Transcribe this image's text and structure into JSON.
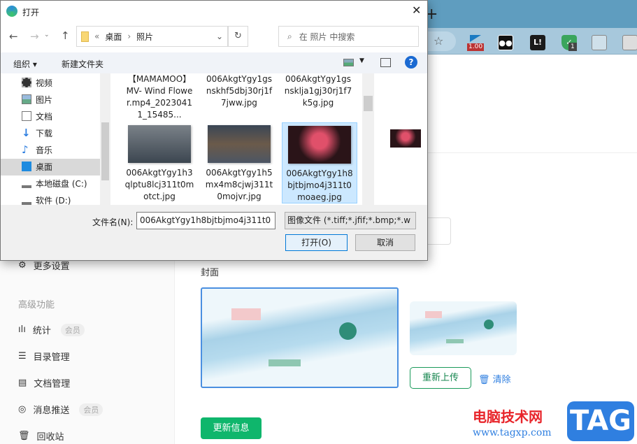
{
  "browser": {
    "new_tab": "+",
    "extensions": [
      {
        "name": "ext-flag",
        "badge": "1.00"
      },
      {
        "name": "ext-owl"
      },
      {
        "name": "ext-l",
        "label": "L!"
      },
      {
        "name": "ext-shield",
        "badge": "1"
      },
      {
        "name": "ext-image"
      },
      {
        "name": "ext-copy"
      }
    ]
  },
  "sidebar": {
    "more_settings": "更多设置",
    "section": "高级功能",
    "items": [
      {
        "label": "统计",
        "badge": "会员"
      },
      {
        "label": "目录管理"
      },
      {
        "label": "文档管理"
      },
      {
        "label": "消息推送",
        "badge": "会员"
      },
      {
        "label": "回收站"
      }
    ]
  },
  "main": {
    "cover_label": "封面",
    "reupload": "重新上传",
    "clear": "清除",
    "update": "更新信息"
  },
  "watermark": {
    "site": "电脑技术网",
    "url": "www.tagxp.com",
    "logo": "TAG"
  },
  "dialog": {
    "title": "打开",
    "breadcrumb": [
      "桌面",
      "照片"
    ],
    "breadcrumb_prefix": "«",
    "search_placeholder": "在 照片 中搜索",
    "organize": "组织 ▾",
    "new_folder": "新建文件夹",
    "help": "?",
    "nav": [
      "视频",
      "图片",
      "文档",
      "下载",
      "音乐",
      "桌面",
      "本地磁盘 (C:)",
      "软件 (D:)"
    ],
    "files": [
      {
        "name": "【MAMAMOO】MV- Wind Flower.mp4_20230411_15485...",
        "lines": [
          "【MAMAMOO",
          "】MV- Wind",
          "Flower.mp4_20",
          "230411_15485..."
        ]
      },
      {
        "lines": [
          "006AkgtYgy1gs",
          "nskhf5dbj30rj1f",
          "7jww.jpg"
        ]
      },
      {
        "lines": [
          "006AkgtYgy1gs",
          "nsklja1gj30rj1f7",
          "k5g.jpg"
        ]
      },
      {
        "lines": [
          "006AkgtYgy1h3",
          "qlptu8lcj311t0m",
          "otct.jpg"
        ]
      },
      {
        "lines": [
          "006AkgtYgy1h5",
          "mx4m8cjwj311t",
          "0mojvr.jpg"
        ]
      },
      {
        "lines": [
          "006AkgtYgy1h8",
          "bjtbjmo4j311t0",
          "moaeg.jpg"
        ]
      }
    ],
    "filename_label": "文件名(N):",
    "filename_value": "006AkgtYgy1h8bjtbjmo4j311t0",
    "filetype": "图像文件 (*.tiff;*.jfif;*.bmp;*.w",
    "open": "打开(O)",
    "cancel": "取消"
  }
}
